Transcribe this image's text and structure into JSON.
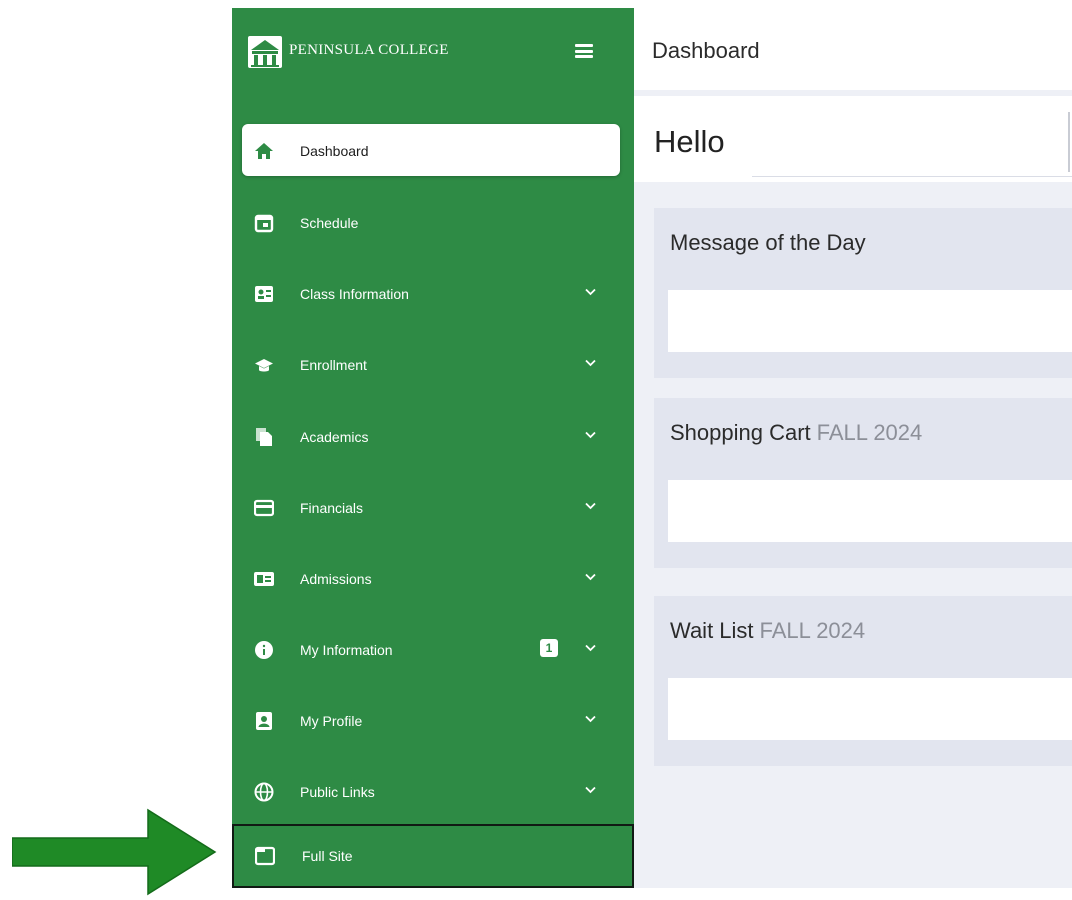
{
  "brand": {
    "name": "PENINSULA COLLEGE",
    "logo_icon": "college-building-logo"
  },
  "colors": {
    "sidebar": "#2e8b45",
    "main_bg": "#eef0f6",
    "card_bg": "#e2e5ef",
    "arrow": "#1f8a26"
  },
  "sidebar": {
    "items": [
      {
        "label": "Dashboard",
        "icon": "home-icon",
        "active": true
      },
      {
        "label": "Schedule",
        "icon": "calendar-icon"
      },
      {
        "label": "Class Information",
        "icon": "id-card-icon",
        "expandable": true
      },
      {
        "label": "Enrollment",
        "icon": "graduation-cap-icon",
        "expandable": true
      },
      {
        "label": "Academics",
        "icon": "documents-icon",
        "expandable": true
      },
      {
        "label": "Financials",
        "icon": "credit-card-icon",
        "expandable": true
      },
      {
        "label": "Admissions",
        "icon": "address-card-icon",
        "expandable": true
      },
      {
        "label": "My Information",
        "icon": "info-icon",
        "expandable": true,
        "badge": "1"
      },
      {
        "label": "My Profile",
        "icon": "user-badge-icon",
        "expandable": true
      },
      {
        "label": "Public Links",
        "icon": "globe-icon",
        "expandable": true
      }
    ],
    "footer": {
      "label": "Full Site",
      "icon": "window-icon"
    }
  },
  "header": {
    "title": "Dashboard"
  },
  "main": {
    "greeting": "Hello",
    "cards": [
      {
        "title": "Message of the Day",
        "subtitle": ""
      },
      {
        "title": "Shopping Cart",
        "subtitle": "FALL 2024"
      },
      {
        "title": "Wait List",
        "subtitle": "FALL 2024"
      }
    ]
  }
}
